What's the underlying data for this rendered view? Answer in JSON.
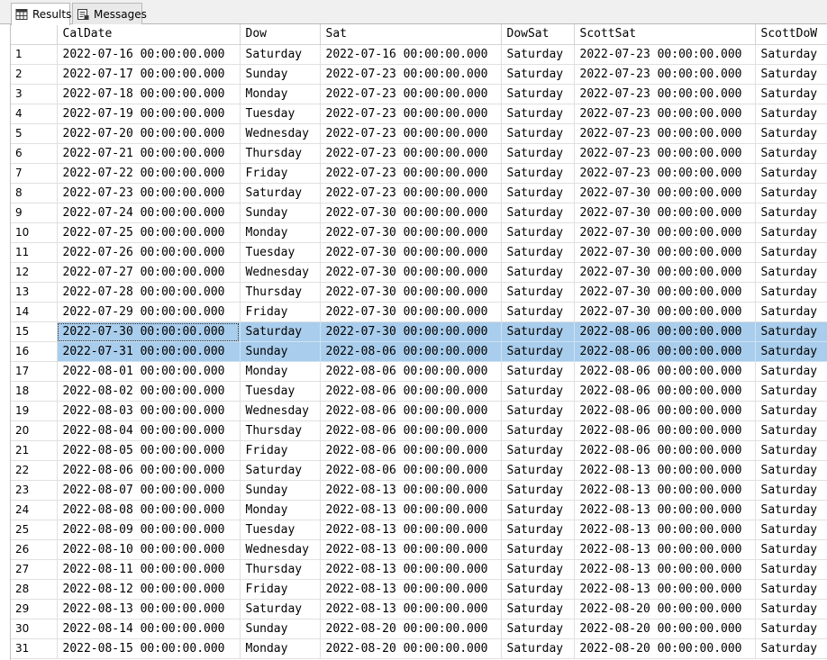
{
  "tabs": [
    {
      "label": "Results",
      "icon": "grid-icon",
      "active": true
    },
    {
      "label": "Messages",
      "icon": "messages-icon",
      "active": false
    }
  ],
  "columns": [
    "CalDate",
    "Dow",
    "Sat",
    "DowSat",
    "ScottSat",
    "ScottDoW"
  ],
  "selected_rows": [
    15,
    16
  ],
  "rows": [
    [
      "1",
      "2022-07-16 00:00:00.000",
      "Saturday",
      "2022-07-16 00:00:00.000",
      "Saturday",
      "2022-07-23 00:00:00.000",
      "Saturday"
    ],
    [
      "2",
      "2022-07-17 00:00:00.000",
      "Sunday",
      "2022-07-23 00:00:00.000",
      "Saturday",
      "2022-07-23 00:00:00.000",
      "Saturday"
    ],
    [
      "3",
      "2022-07-18 00:00:00.000",
      "Monday",
      "2022-07-23 00:00:00.000",
      "Saturday",
      "2022-07-23 00:00:00.000",
      "Saturday"
    ],
    [
      "4",
      "2022-07-19 00:00:00.000",
      "Tuesday",
      "2022-07-23 00:00:00.000",
      "Saturday",
      "2022-07-23 00:00:00.000",
      "Saturday"
    ],
    [
      "5",
      "2022-07-20 00:00:00.000",
      "Wednesday",
      "2022-07-23 00:00:00.000",
      "Saturday",
      "2022-07-23 00:00:00.000",
      "Saturday"
    ],
    [
      "6",
      "2022-07-21 00:00:00.000",
      "Thursday",
      "2022-07-23 00:00:00.000",
      "Saturday",
      "2022-07-23 00:00:00.000",
      "Saturday"
    ],
    [
      "7",
      "2022-07-22 00:00:00.000",
      "Friday",
      "2022-07-23 00:00:00.000",
      "Saturday",
      "2022-07-23 00:00:00.000",
      "Saturday"
    ],
    [
      "8",
      "2022-07-23 00:00:00.000",
      "Saturday",
      "2022-07-23 00:00:00.000",
      "Saturday",
      "2022-07-30 00:00:00.000",
      "Saturday"
    ],
    [
      "9",
      "2022-07-24 00:00:00.000",
      "Sunday",
      "2022-07-30 00:00:00.000",
      "Saturday",
      "2022-07-30 00:00:00.000",
      "Saturday"
    ],
    [
      "10",
      "2022-07-25 00:00:00.000",
      "Monday",
      "2022-07-30 00:00:00.000",
      "Saturday",
      "2022-07-30 00:00:00.000",
      "Saturday"
    ],
    [
      "11",
      "2022-07-26 00:00:00.000",
      "Tuesday",
      "2022-07-30 00:00:00.000",
      "Saturday",
      "2022-07-30 00:00:00.000",
      "Saturday"
    ],
    [
      "12",
      "2022-07-27 00:00:00.000",
      "Wednesday",
      "2022-07-30 00:00:00.000",
      "Saturday",
      "2022-07-30 00:00:00.000",
      "Saturday"
    ],
    [
      "13",
      "2022-07-28 00:00:00.000",
      "Thursday",
      "2022-07-30 00:00:00.000",
      "Saturday",
      "2022-07-30 00:00:00.000",
      "Saturday"
    ],
    [
      "14",
      "2022-07-29 00:00:00.000",
      "Friday",
      "2022-07-30 00:00:00.000",
      "Saturday",
      "2022-07-30 00:00:00.000",
      "Saturday"
    ],
    [
      "15",
      "2022-07-30 00:00:00.000",
      "Saturday",
      "2022-07-30 00:00:00.000",
      "Saturday",
      "2022-08-06 00:00:00.000",
      "Saturday"
    ],
    [
      "16",
      "2022-07-31 00:00:00.000",
      "Sunday",
      "2022-08-06 00:00:00.000",
      "Saturday",
      "2022-08-06 00:00:00.000",
      "Saturday"
    ],
    [
      "17",
      "2022-08-01 00:00:00.000",
      "Monday",
      "2022-08-06 00:00:00.000",
      "Saturday",
      "2022-08-06 00:00:00.000",
      "Saturday"
    ],
    [
      "18",
      "2022-08-02 00:00:00.000",
      "Tuesday",
      "2022-08-06 00:00:00.000",
      "Saturday",
      "2022-08-06 00:00:00.000",
      "Saturday"
    ],
    [
      "19",
      "2022-08-03 00:00:00.000",
      "Wednesday",
      "2022-08-06 00:00:00.000",
      "Saturday",
      "2022-08-06 00:00:00.000",
      "Saturday"
    ],
    [
      "20",
      "2022-08-04 00:00:00.000",
      "Thursday",
      "2022-08-06 00:00:00.000",
      "Saturday",
      "2022-08-06 00:00:00.000",
      "Saturday"
    ],
    [
      "21",
      "2022-08-05 00:00:00.000",
      "Friday",
      "2022-08-06 00:00:00.000",
      "Saturday",
      "2022-08-06 00:00:00.000",
      "Saturday"
    ],
    [
      "22",
      "2022-08-06 00:00:00.000",
      "Saturday",
      "2022-08-06 00:00:00.000",
      "Saturday",
      "2022-08-13 00:00:00.000",
      "Saturday"
    ],
    [
      "23",
      "2022-08-07 00:00:00.000",
      "Sunday",
      "2022-08-13 00:00:00.000",
      "Saturday",
      "2022-08-13 00:00:00.000",
      "Saturday"
    ],
    [
      "24",
      "2022-08-08 00:00:00.000",
      "Monday",
      "2022-08-13 00:00:00.000",
      "Saturday",
      "2022-08-13 00:00:00.000",
      "Saturday"
    ],
    [
      "25",
      "2022-08-09 00:00:00.000",
      "Tuesday",
      "2022-08-13 00:00:00.000",
      "Saturday",
      "2022-08-13 00:00:00.000",
      "Saturday"
    ],
    [
      "26",
      "2022-08-10 00:00:00.000",
      "Wednesday",
      "2022-08-13 00:00:00.000",
      "Saturday",
      "2022-08-13 00:00:00.000",
      "Saturday"
    ],
    [
      "27",
      "2022-08-11 00:00:00.000",
      "Thursday",
      "2022-08-13 00:00:00.000",
      "Saturday",
      "2022-08-13 00:00:00.000",
      "Saturday"
    ],
    [
      "28",
      "2022-08-12 00:00:00.000",
      "Friday",
      "2022-08-13 00:00:00.000",
      "Saturday",
      "2022-08-13 00:00:00.000",
      "Saturday"
    ],
    [
      "29",
      "2022-08-13 00:00:00.000",
      "Saturday",
      "2022-08-13 00:00:00.000",
      "Saturday",
      "2022-08-20 00:00:00.000",
      "Saturday"
    ],
    [
      "30",
      "2022-08-14 00:00:00.000",
      "Sunday",
      "2022-08-20 00:00:00.000",
      "Saturday",
      "2022-08-20 00:00:00.000",
      "Saturday"
    ],
    [
      "31",
      "2022-08-15 00:00:00.000",
      "Monday",
      "2022-08-20 00:00:00.000",
      "Saturday",
      "2022-08-20 00:00:00.000",
      "Saturday"
    ]
  ]
}
